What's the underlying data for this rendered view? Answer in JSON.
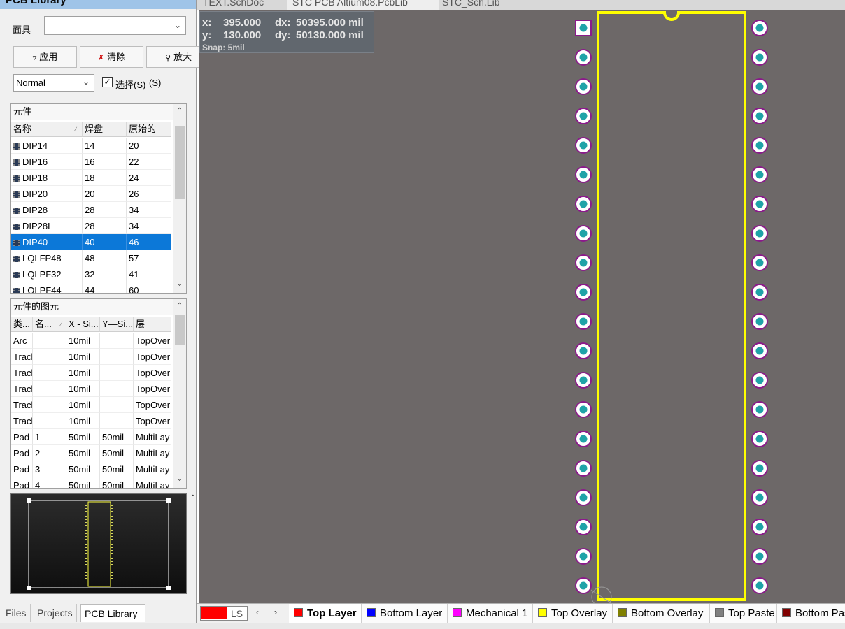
{
  "panel": {
    "title": "PCB Library",
    "mask_label": "面具",
    "mask_value": "",
    "apply_label": "应用",
    "clear_label": "清除",
    "zoom_label": "放大",
    "mode_value": "Normal",
    "select_label": "选择(S)",
    "select_shortcut": "(S)",
    "select_checked": true
  },
  "components": {
    "title": "元件",
    "headers": [
      "名称",
      "焊盘",
      "原始的"
    ],
    "rows": [
      [
        "DIP14",
        "14",
        "20"
      ],
      [
        "DIP16",
        "16",
        "22"
      ],
      [
        "DIP18",
        "18",
        "24"
      ],
      [
        "DIP20",
        "20",
        "26"
      ],
      [
        "DIP28",
        "28",
        "34"
      ],
      [
        "DIP28L",
        "28",
        "34"
      ],
      [
        "DIP40",
        "40",
        "46"
      ],
      [
        "LQLFP48",
        "48",
        "57"
      ],
      [
        "LQLPF32",
        "32",
        "41"
      ],
      [
        "LQLPF44",
        "44",
        "60"
      ]
    ],
    "selected_index": 6
  },
  "primitives": {
    "title": "元件的图元",
    "headers": [
      "类...",
      "名...",
      "X - Si...",
      "Y—Si...",
      "层"
    ],
    "rows": [
      [
        "Arc",
        "",
        "10mil",
        "",
        "TopOver"
      ],
      [
        "Track",
        "",
        "10mil",
        "",
        "TopOver"
      ],
      [
        "Track",
        "",
        "10mil",
        "",
        "TopOver"
      ],
      [
        "Track",
        "",
        "10mil",
        "",
        "TopOver"
      ],
      [
        "Track",
        "",
        "10mil",
        "",
        "TopOver"
      ],
      [
        "Track",
        "",
        "10mil",
        "",
        "TopOver"
      ],
      [
        "Pad",
        "1",
        "50mil",
        "50mil",
        "MultiLay"
      ],
      [
        "Pad",
        "2",
        "50mil",
        "50mil",
        "MultiLay"
      ],
      [
        "Pad",
        "3",
        "50mil",
        "50mil",
        "MultiLay"
      ],
      [
        "Pad",
        "4",
        "50mil",
        "50mil",
        "MultiLay"
      ]
    ]
  },
  "panel_tabs": [
    "Files",
    "Projects",
    "PCB Library"
  ],
  "active_panel_tab": "PCB Library",
  "doc_tabs": [
    "TEXT.SchDoc",
    "STC PCB Altium08.PcbLib",
    "STC_Sch.Lib"
  ],
  "coords": {
    "x_label": "x:",
    "x_value": "395.000",
    "dx_label": "dx:",
    "dx_value": "50395.000 mil",
    "y_label": "y:",
    "y_value": "130.000",
    "dy_label": "dy:",
    "dy_value": "50130.000 mil",
    "snap": "Snap: 5mil"
  },
  "footprint": {
    "pins_per_side": 20,
    "overlay_color": "#ffff00",
    "pad_ring_color": "#8b1a8b",
    "pad_hole_color": "#1fa3a8",
    "pad_body_color": "#ffffff"
  },
  "layer_bar": {
    "current_color": "#ff0000",
    "current_short": "LS",
    "layers": [
      {
        "name": "Top Layer",
        "color": "#ff0000",
        "active": true
      },
      {
        "name": "Bottom Layer",
        "color": "#0000ff"
      },
      {
        "name": "Mechanical 1",
        "color": "#ff00ff"
      },
      {
        "name": "Top Overlay",
        "color": "#ffff00"
      },
      {
        "name": "Bottom Overlay",
        "color": "#808000"
      },
      {
        "name": "Top Paste",
        "color": "#808080"
      },
      {
        "name": "Bottom Paste",
        "color": "#800000"
      }
    ]
  },
  "colors": {
    "canvas_bg": "#6d6868",
    "selection": "#0c78d8",
    "title_bar": "#9fc4e8"
  }
}
